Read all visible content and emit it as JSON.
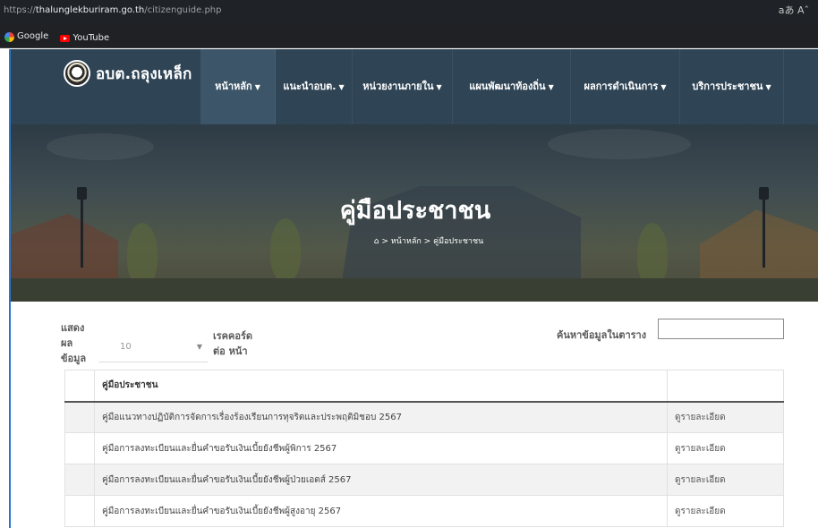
{
  "browser": {
    "url_prefix": "https://",
    "url_host": "thalunglekburiram.go.th",
    "url_path": "/citizenguide.php",
    "right_icons": "aあ  Aˆ",
    "bookmarks": [
      {
        "label": "Google",
        "icon": "google-icon"
      },
      {
        "label": "YouTube",
        "icon": "youtube-icon"
      }
    ]
  },
  "site": {
    "logo_text": "อบต.ถลุงเหล็ก",
    "nav": [
      {
        "label": "หน้าหลัก",
        "active": true
      },
      {
        "label": "แนะนำอบต.",
        "active": false
      },
      {
        "label": "หน่วยงานภายใน",
        "active": false
      },
      {
        "label": "แผนพัฒนาท้องถิ่น",
        "active": false
      },
      {
        "label": "ผลการดำเนินการ",
        "active": false
      },
      {
        "label": "บริการประชาชน",
        "active": false
      }
    ]
  },
  "banner": {
    "title": "คู่มือประชาชน",
    "breadcrumb_home": "หน้าหลัก",
    "breadcrumb_current": "คู่มือประชาชน"
  },
  "table_controls": {
    "show_label": "แสดง ผล ข้อมูล",
    "page_length": "10",
    "records_label": "เรคคอร์ด ต่อ หน้า",
    "search_label": "ค้นหาข้อมูลในตาราง",
    "search_value": ""
  },
  "table": {
    "header": "คู่มือประชาชน",
    "detail_link": "ดูรายละเอียด",
    "rows": [
      "คู่มือแนวทางปฏิบัติการจัดการเรื่องร้องเรียนการทุจริตและประพฤติมิชอบ 2567",
      "คู่มือการลงทะเบียนและยื่นคำขอรับเงินเบี้ยยังชีพผู้พิการ 2567",
      "คู่มือการลงทะเบียนและยื่นคำขอรับเงินเบี้ยยังชีพผู้ป่วยเอดส์ 2567",
      "คู่มือการลงทะเบียนและยื่นคำขอรับเงินเบี้ยยังชีพผู้สูงอายุ 2567"
    ]
  }
}
